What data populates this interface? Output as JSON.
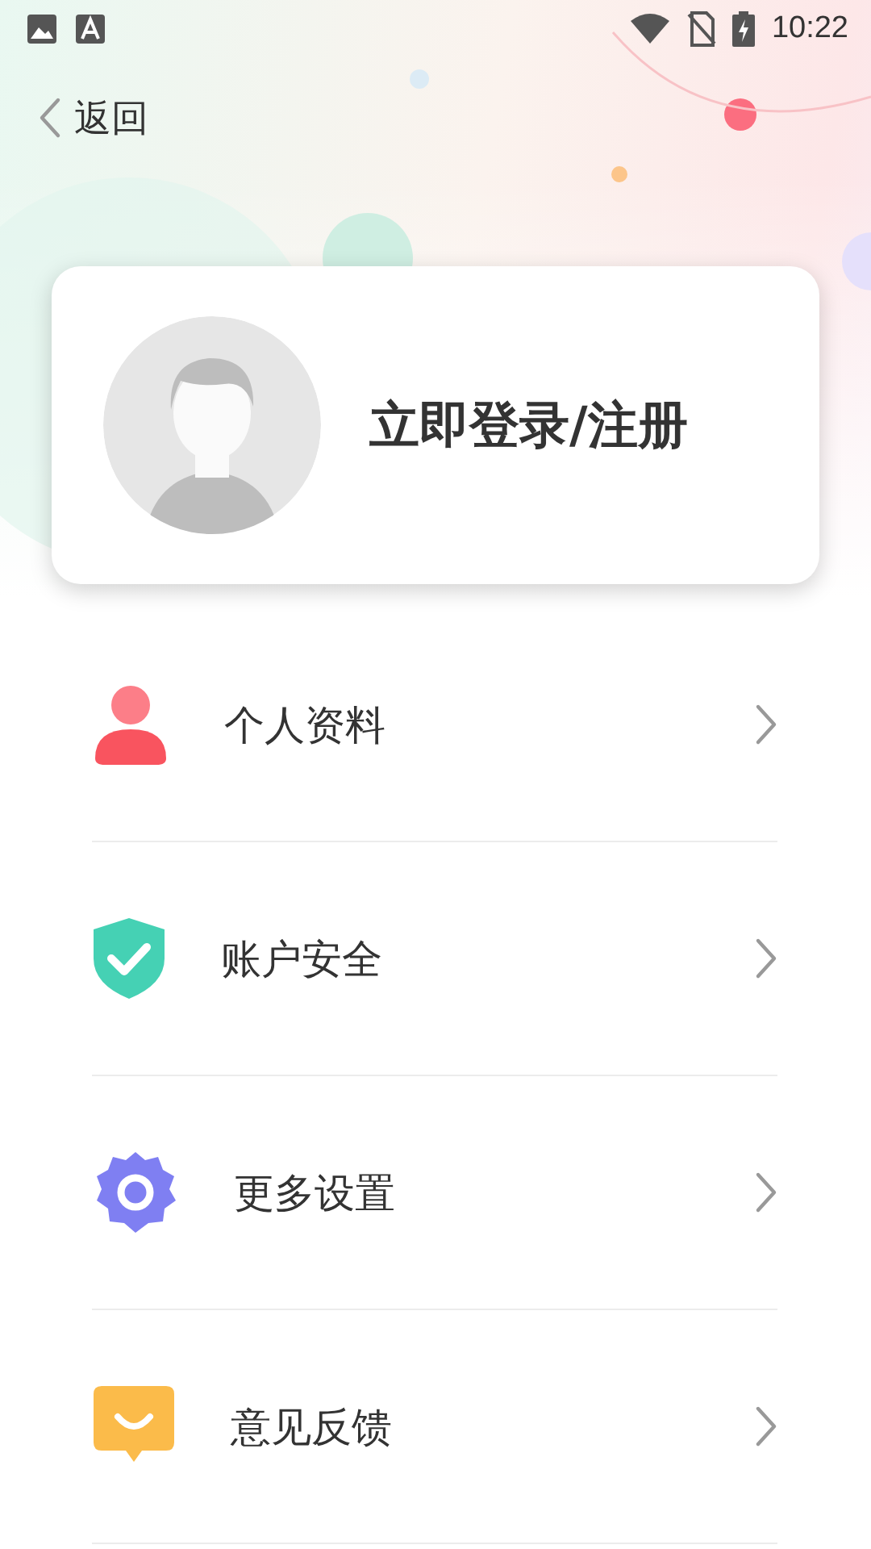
{
  "status_bar": {
    "time": "10:22"
  },
  "header": {
    "back_label": "返回"
  },
  "profile": {
    "login_label": "立即登录/注册"
  },
  "menu": {
    "items": [
      {
        "label": "个人资料",
        "kind": "profile"
      },
      {
        "label": "账户安全",
        "kind": "security"
      },
      {
        "label": "更多设置",
        "kind": "settings"
      },
      {
        "label": "意见反馈",
        "kind": "feedback"
      }
    ]
  }
}
